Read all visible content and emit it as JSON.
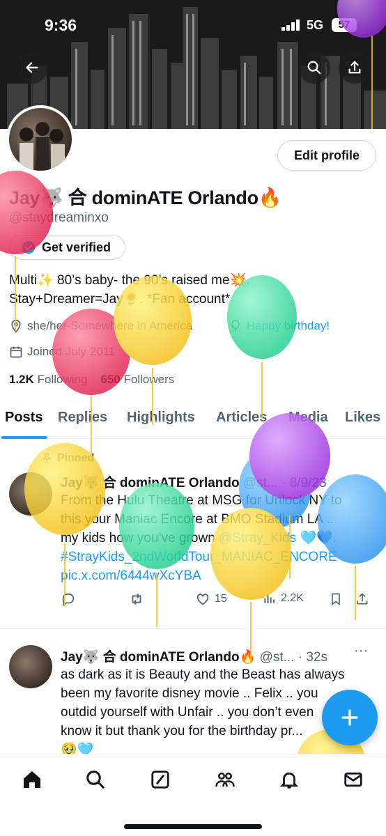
{
  "status_bar": {
    "time": "9:36",
    "network": "5G",
    "battery": "57"
  },
  "header": {
    "back_icon": "arrow-left-icon",
    "search_icon": "search-icon",
    "share_icon": "share-icon"
  },
  "profile": {
    "name": "Jay🐺 合 dominATE Orlando🔥",
    "handle": "@staydreaminxo",
    "edit_label": "Edit profile",
    "verified_label": "Get verified",
    "bio_line1": "Multi✨ 80’s baby- the 90’s raised me💥.",
    "bio_line2": "Stay+Dreamer=Jay🌻. *Fan account*",
    "location": "she/her-Somewhere in America",
    "birthday": "Happy birthday!",
    "joined": "Joined July 2011",
    "following_count": "1.2K",
    "following_label": "Following",
    "followers_count": "650",
    "followers_label": "Followers"
  },
  "tabs": [
    {
      "label": "Posts"
    },
    {
      "label": "Replies"
    },
    {
      "label": "Highlights"
    },
    {
      "label": "Articles"
    },
    {
      "label": "Media"
    },
    {
      "label": "Likes"
    }
  ],
  "tweets": [
    {
      "pinned": "Pinned",
      "name": "Jay🐺 合 dominATE Orlando",
      "meta": "@st... · 8/9/23",
      "line1": "From the Hulu Theatre at MSG for Unlock NY to",
      "line2": "this your Maniac Encore at BMO Stadium LA ..",
      "line3_pre": "my kids how you’ve grown ",
      "line3_link": "@Stray_Kids",
      "line3_post": " 🩵💙.",
      "hashtag": "#StrayKids_2ndWorldTour_MANIAC_ENCORE",
      "pic_link": "pic.x.com/6444wXcYBA",
      "likes": "15",
      "views": "2.2K"
    },
    {
      "name": "Jay🐺 合 dominATE Orlando🔥",
      "meta": "@st... · 32s",
      "line1": "as dark as it is Beauty and the Beast has always",
      "line2": "been my favorite disney movie .. Felix .. you",
      "line3": "outdid yourself with Unfair .. you don’t even",
      "line4": "know it but thank you for the birthday pr...",
      "line5": "🥹🩵"
    }
  ],
  "nav": [
    "home-icon",
    "search-icon",
    "grok-icon",
    "communities-icon",
    "notifications-icon",
    "messages-icon"
  ],
  "colors": {
    "accent": "#1d9bf0",
    "text": "#0f1419",
    "muted": "#536471"
  }
}
